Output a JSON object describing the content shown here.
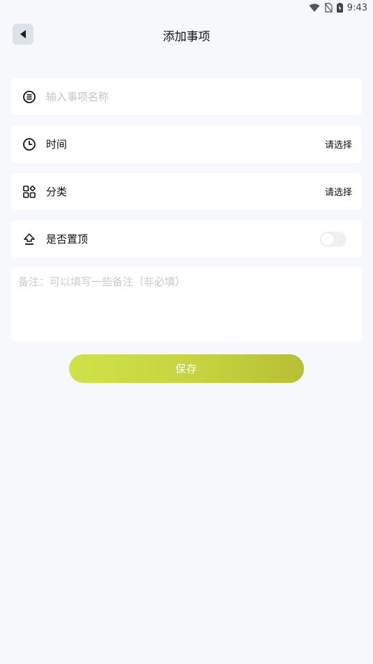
{
  "status_bar": {
    "time": "9:43",
    "icons": [
      "wifi-icon",
      "no-sim-icon",
      "battery-charging-icon"
    ]
  },
  "header": {
    "back_icon": "triangle-left-icon",
    "title": "添加事项"
  },
  "form": {
    "name": {
      "icon": "equal-circle-icon",
      "placeholder": "输入事项名称",
      "value": ""
    },
    "time": {
      "icon": "clock-icon",
      "label": "时间",
      "value": "请选择"
    },
    "category": {
      "icon": "grid-shapes-icon",
      "label": "分类",
      "value": "请选择"
    },
    "pin": {
      "icon": "pin-top-icon",
      "label": "是否置顶",
      "enabled": false
    },
    "remark": {
      "placeholder": "备注：可以填写一些备注（非必填）",
      "value": ""
    }
  },
  "actions": {
    "save_label": "保存"
  },
  "colors": {
    "background": "#f7f8fc",
    "card": "#ffffff",
    "accent_start": "#cfe24a",
    "accent_end": "#b7bf33",
    "back_button_bg": "#dde1e8"
  }
}
